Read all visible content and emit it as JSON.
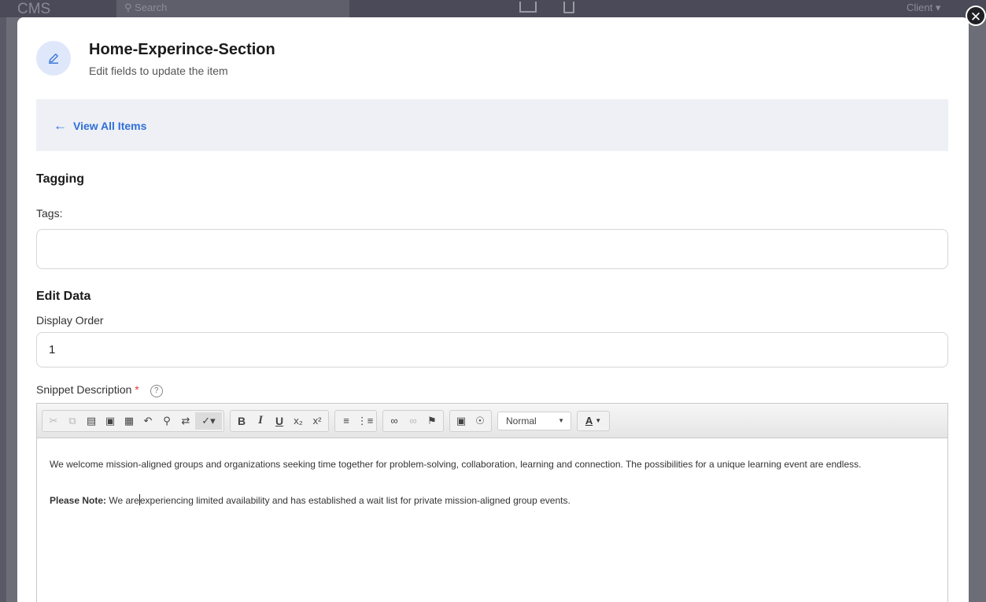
{
  "background": {
    "logo": "CMS",
    "search_placeholder": "Search",
    "user_menu": "Client"
  },
  "modal": {
    "title": "Home-Experince-Section",
    "subtitle": "Edit fields to update the item",
    "close_icon": "close-icon",
    "back_link": "View All Items",
    "tagging_heading": "Tagging",
    "tags_label": "Tags",
    "tags_value": "",
    "edit_heading": "Edit Data",
    "display_order_label": "Display Order",
    "display_order_value": "1",
    "snippet_label": "Snippet Description",
    "required_mark": "*",
    "help_glyph": "?"
  },
  "editor": {
    "format_select": "Normal",
    "color_label": "A",
    "paragraph1": "We welcome mission-aligned groups and organizations seeking time together for problem-solving, collaboration, learning and connection. The possibilities for a unique learning event are endless.",
    "note_label": "Please Note:",
    "paragraph2_before": "We are",
    "paragraph2_after": "experiencing limited availability and has established a wait list for private mission-aligned group events."
  },
  "colors": {
    "accent": "#2f6fd6",
    "required": "#e03b3b",
    "nav_bg": "#eef0f6",
    "overlay": "#6d6d78"
  }
}
